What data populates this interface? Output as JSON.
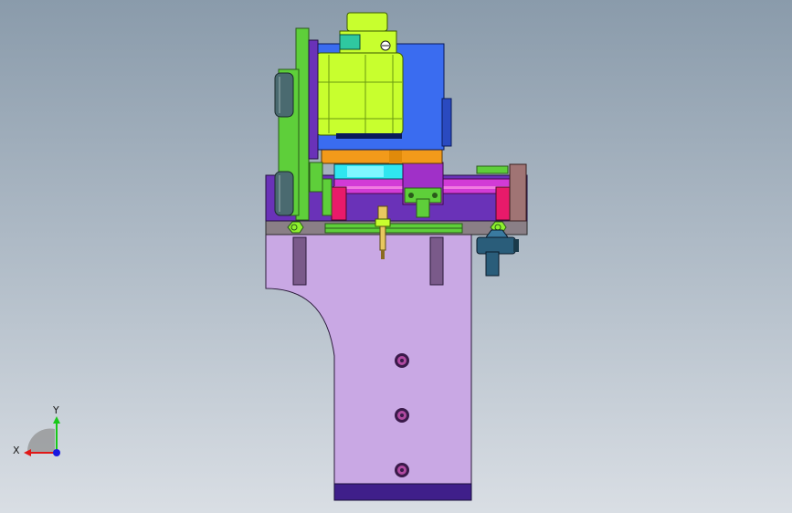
{
  "viewport": {
    "background_top": "#8a9bab",
    "background_bottom": "#d9dee4"
  },
  "model": {
    "colors": {
      "motor": "#c8ff2e",
      "motor_dark": "#4a6a00",
      "block_blue": "#3a6cf0",
      "frame_purple": "#6a32b8",
      "base_lilac": "#c9a8e4",
      "base_dark": "#3f1f8a",
      "plate_gray": "#8a7f86",
      "rail_magenta": "#d23bd6",
      "cyan": "#2fe6f0",
      "orange": "#f29a1a",
      "green": "#5ecf3a",
      "knob_blue": "#2a5d7a",
      "brown": "#a07474"
    }
  },
  "triad": {
    "x_label": "X",
    "y_label": "Y",
    "x_color": "#e01818",
    "y_color": "#18c818",
    "z_color": "#1818e0"
  }
}
